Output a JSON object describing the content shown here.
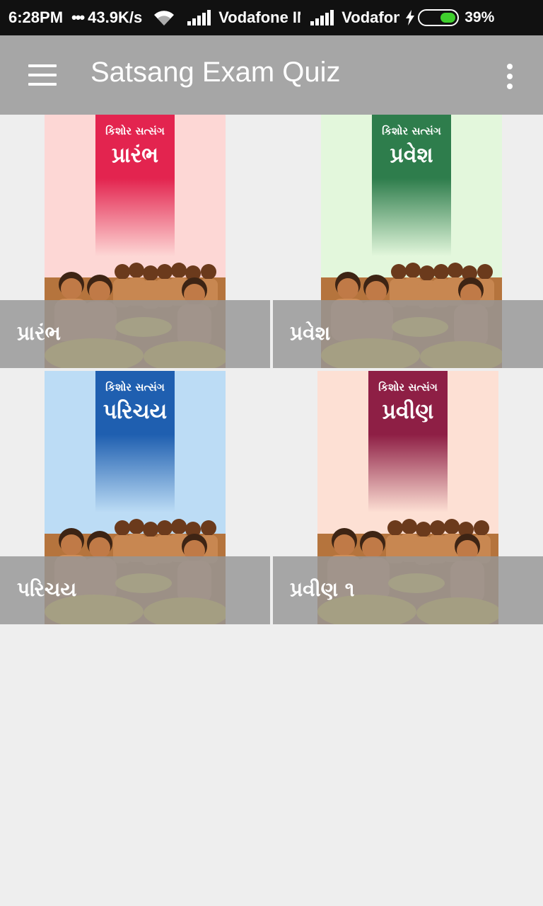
{
  "status_bar": {
    "time": "6:28PM",
    "dots": "•••",
    "network_speed": "43.9K/s",
    "carrier_1": "Vodafone IN",
    "carrier_2": "Vodafone",
    "battery_percent": "39%",
    "battery_level": 0.39,
    "battery_color": "#3fcf2d"
  },
  "toolbar": {
    "title": "Satsang Exam Quiz",
    "background": "#a6a6a6"
  },
  "tiles": [
    {
      "label": "પ્રારંભ",
      "cover_series": "કિશોર સત્સંગ",
      "cover_title": "પ્રારંભ",
      "cover_bg": "#fdd7d5",
      "band_color": "#e3244f"
    },
    {
      "label": "પ્રવેશ",
      "cover_series": "કિશોર સત્સંગ",
      "cover_title": "પ્રવેશ",
      "cover_bg": "#e3f7dc",
      "band_color": "#2e7d4c"
    },
    {
      "label": "પરિચય",
      "cover_series": "કિશોર સત્સંગ",
      "cover_title": "પરિચય",
      "cover_bg": "#bcdcf5",
      "band_color": "#1f5fb0"
    },
    {
      "label": "પ્રવીણ ૧",
      "cover_series": "કિશોર સત્સંગ",
      "cover_title": "પ્રવીણ",
      "cover_bg": "#fde0d4",
      "band_color": "#8e1f45"
    }
  ]
}
